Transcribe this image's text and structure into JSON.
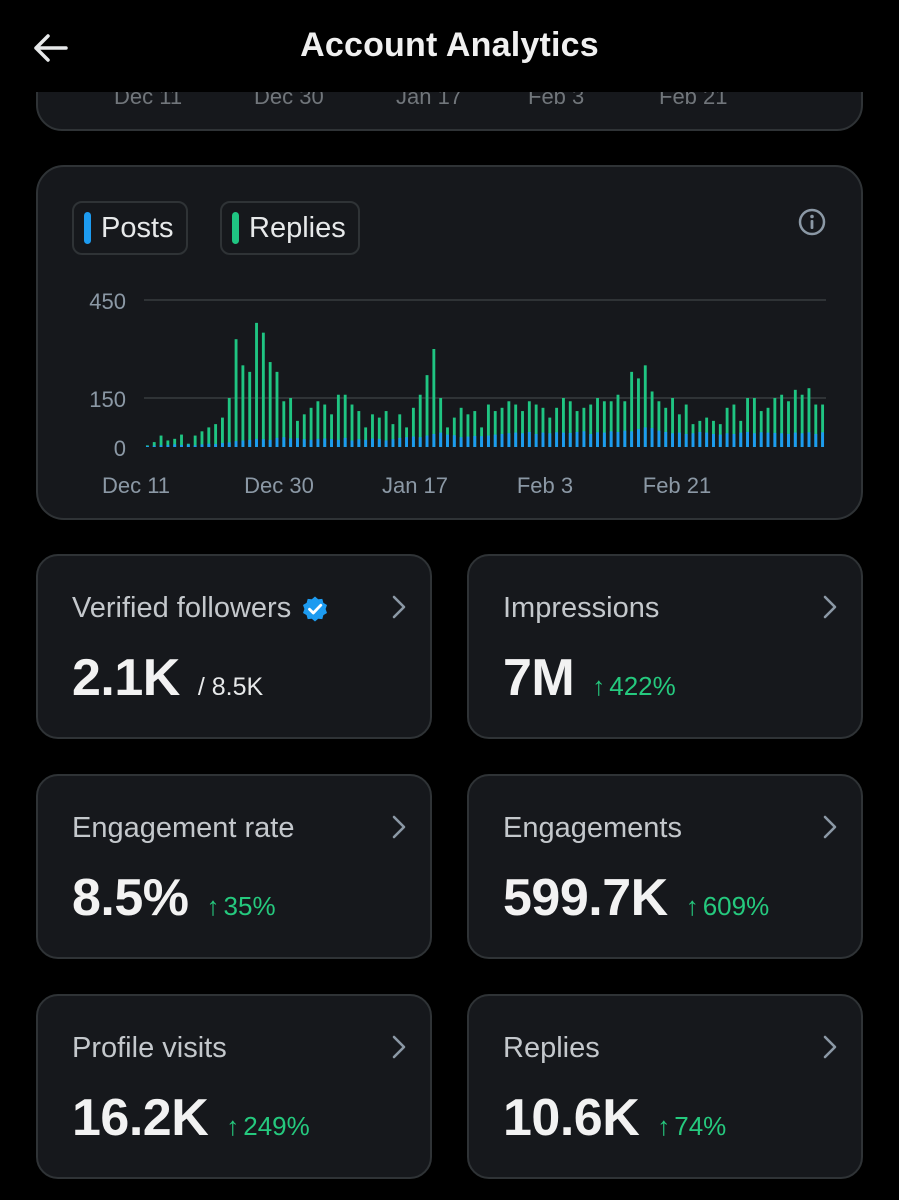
{
  "header": {
    "title": "Account Analytics",
    "back_icon": "arrow-left-icon"
  },
  "top_chart": {
    "ticks": [
      "Dec 11",
      "Dec 30",
      "Jan 17",
      "Feb 3",
      "Feb 21"
    ]
  },
  "legend": {
    "posts": "Posts",
    "replies": "Replies"
  },
  "colors": {
    "posts": "#1d9bf0",
    "replies": "#1fc582",
    "positive": "#25c97e",
    "card_bg": "#16181c",
    "card_border": "#2f3336",
    "verified": "#1d9bf0"
  },
  "chart_data": {
    "type": "bar",
    "ylim": [
      0,
      450
    ],
    "yticks": [
      "450",
      "150",
      "0"
    ],
    "xticks": [
      "Dec 11",
      "Dec 30",
      "Jan 17",
      "Feb 3",
      "Feb 21"
    ],
    "grid": true,
    "legend_position": "top-left",
    "series": [
      {
        "name": "Posts",
        "values": [
          3,
          4,
          5,
          6,
          8,
          6,
          7,
          5,
          8,
          10,
          9,
          12,
          14,
          18,
          20,
          22,
          25,
          24,
          22,
          28,
          30,
          26,
          27,
          24,
          22,
          25,
          26,
          24,
          22,
          28,
          20,
          24,
          22,
          26,
          25,
          20,
          24,
          28,
          30,
          32,
          30,
          35,
          40,
          44,
          38,
          36,
          30,
          32,
          34,
          33,
          35,
          38,
          40,
          42,
          44,
          42,
          46,
          40,
          44,
          42,
          45,
          44,
          43,
          46,
          48,
          40,
          45,
          44,
          48,
          46,
          50,
          48,
          55,
          60,
          58,
          50,
          46,
          42,
          44,
          40,
          42,
          46,
          44,
          40,
          38,
          42,
          40,
          44,
          46,
          42,
          45,
          44,
          43,
          42,
          40,
          44,
          42,
          45,
          40,
          45
        ]
      },
      {
        "name": "Replies",
        "values": [
          5,
          15,
          35,
          20,
          25,
          38,
          10,
          35,
          48,
          60,
          70,
          90,
          150,
          330,
          250,
          230,
          380,
          350,
          260,
          230,
          140,
          150,
          80,
          100,
          120,
          140,
          130,
          100,
          160,
          160,
          130,
          110,
          60,
          100,
          90,
          110,
          70,
          100,
          60,
          120,
          160,
          220,
          300,
          150,
          60,
          90,
          120,
          100,
          110,
          60,
          130,
          110,
          120,
          140,
          130,
          110,
          140,
          130,
          120,
          90,
          120,
          150,
          140,
          110,
          120,
          130,
          150,
          140,
          140,
          160,
          140,
          230,
          210,
          250,
          170,
          140,
          120,
          150,
          100,
          130,
          70,
          80,
          90,
          80,
          70,
          120,
          130,
          80,
          150,
          150,
          110,
          120,
          150,
          160,
          140,
          175,
          160,
          180,
          130,
          130
        ]
      }
    ]
  },
  "stats": {
    "verified_followers": {
      "label": "Verified followers",
      "value": "2.1K",
      "sub": "/ 8.5K"
    },
    "impressions": {
      "label": "Impressions",
      "value": "7M",
      "arrow": "↑",
      "change": "422%"
    },
    "engagement_rate": {
      "label": "Engagement rate",
      "value": "8.5%",
      "arrow": "↑",
      "change": "35%"
    },
    "engagements": {
      "label": "Engagements",
      "value": "599.7K",
      "arrow": "↑",
      "change": "609%"
    },
    "profile_visits": {
      "label": "Profile visits",
      "value": "16.2K",
      "arrow": "↑",
      "change": "249%"
    },
    "replies": {
      "label": "Replies",
      "value": "10.6K",
      "arrow": "↑",
      "change": "74%"
    }
  }
}
